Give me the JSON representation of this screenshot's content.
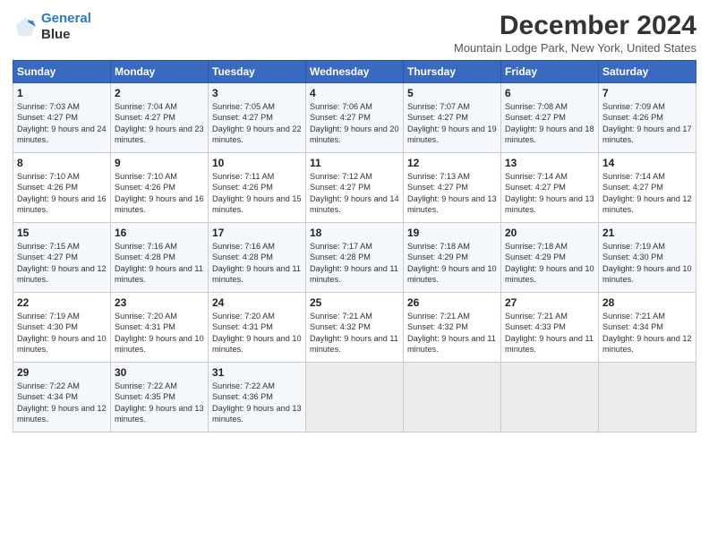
{
  "logo": {
    "line1": "General",
    "line2": "Blue"
  },
  "title": "December 2024",
  "location": "Mountain Lodge Park, New York, United States",
  "days_header": [
    "Sunday",
    "Monday",
    "Tuesday",
    "Wednesday",
    "Thursday",
    "Friday",
    "Saturday"
  ],
  "weeks": [
    [
      {
        "day": "1",
        "sunrise": "Sunrise: 7:03 AM",
        "sunset": "Sunset: 4:27 PM",
        "daylight": "Daylight: 9 hours and 24 minutes."
      },
      {
        "day": "2",
        "sunrise": "Sunrise: 7:04 AM",
        "sunset": "Sunset: 4:27 PM",
        "daylight": "Daylight: 9 hours and 23 minutes."
      },
      {
        "day": "3",
        "sunrise": "Sunrise: 7:05 AM",
        "sunset": "Sunset: 4:27 PM",
        "daylight": "Daylight: 9 hours and 22 minutes."
      },
      {
        "day": "4",
        "sunrise": "Sunrise: 7:06 AM",
        "sunset": "Sunset: 4:27 PM",
        "daylight": "Daylight: 9 hours and 20 minutes."
      },
      {
        "day": "5",
        "sunrise": "Sunrise: 7:07 AM",
        "sunset": "Sunset: 4:27 PM",
        "daylight": "Daylight: 9 hours and 19 minutes."
      },
      {
        "day": "6",
        "sunrise": "Sunrise: 7:08 AM",
        "sunset": "Sunset: 4:27 PM",
        "daylight": "Daylight: 9 hours and 18 minutes."
      },
      {
        "day": "7",
        "sunrise": "Sunrise: 7:09 AM",
        "sunset": "Sunset: 4:26 PM",
        "daylight": "Daylight: 9 hours and 17 minutes."
      }
    ],
    [
      {
        "day": "8",
        "sunrise": "Sunrise: 7:10 AM",
        "sunset": "Sunset: 4:26 PM",
        "daylight": "Daylight: 9 hours and 16 minutes."
      },
      {
        "day": "9",
        "sunrise": "Sunrise: 7:10 AM",
        "sunset": "Sunset: 4:26 PM",
        "daylight": "Daylight: 9 hours and 16 minutes."
      },
      {
        "day": "10",
        "sunrise": "Sunrise: 7:11 AM",
        "sunset": "Sunset: 4:26 PM",
        "daylight": "Daylight: 9 hours and 15 minutes."
      },
      {
        "day": "11",
        "sunrise": "Sunrise: 7:12 AM",
        "sunset": "Sunset: 4:27 PM",
        "daylight": "Daylight: 9 hours and 14 minutes."
      },
      {
        "day": "12",
        "sunrise": "Sunrise: 7:13 AM",
        "sunset": "Sunset: 4:27 PM",
        "daylight": "Daylight: 9 hours and 13 minutes."
      },
      {
        "day": "13",
        "sunrise": "Sunrise: 7:14 AM",
        "sunset": "Sunset: 4:27 PM",
        "daylight": "Daylight: 9 hours and 13 minutes."
      },
      {
        "day": "14",
        "sunrise": "Sunrise: 7:14 AM",
        "sunset": "Sunset: 4:27 PM",
        "daylight": "Daylight: 9 hours and 12 minutes."
      }
    ],
    [
      {
        "day": "15",
        "sunrise": "Sunrise: 7:15 AM",
        "sunset": "Sunset: 4:27 PM",
        "daylight": "Daylight: 9 hours and 12 minutes."
      },
      {
        "day": "16",
        "sunrise": "Sunrise: 7:16 AM",
        "sunset": "Sunset: 4:28 PM",
        "daylight": "Daylight: 9 hours and 11 minutes."
      },
      {
        "day": "17",
        "sunrise": "Sunrise: 7:16 AM",
        "sunset": "Sunset: 4:28 PM",
        "daylight": "Daylight: 9 hours and 11 minutes."
      },
      {
        "day": "18",
        "sunrise": "Sunrise: 7:17 AM",
        "sunset": "Sunset: 4:28 PM",
        "daylight": "Daylight: 9 hours and 11 minutes."
      },
      {
        "day": "19",
        "sunrise": "Sunrise: 7:18 AM",
        "sunset": "Sunset: 4:29 PM",
        "daylight": "Daylight: 9 hours and 10 minutes."
      },
      {
        "day": "20",
        "sunrise": "Sunrise: 7:18 AM",
        "sunset": "Sunset: 4:29 PM",
        "daylight": "Daylight: 9 hours and 10 minutes."
      },
      {
        "day": "21",
        "sunrise": "Sunrise: 7:19 AM",
        "sunset": "Sunset: 4:30 PM",
        "daylight": "Daylight: 9 hours and 10 minutes."
      }
    ],
    [
      {
        "day": "22",
        "sunrise": "Sunrise: 7:19 AM",
        "sunset": "Sunset: 4:30 PM",
        "daylight": "Daylight: 9 hours and 10 minutes."
      },
      {
        "day": "23",
        "sunrise": "Sunrise: 7:20 AM",
        "sunset": "Sunset: 4:31 PM",
        "daylight": "Daylight: 9 hours and 10 minutes."
      },
      {
        "day": "24",
        "sunrise": "Sunrise: 7:20 AM",
        "sunset": "Sunset: 4:31 PM",
        "daylight": "Daylight: 9 hours and 10 minutes."
      },
      {
        "day": "25",
        "sunrise": "Sunrise: 7:21 AM",
        "sunset": "Sunset: 4:32 PM",
        "daylight": "Daylight: 9 hours and 11 minutes."
      },
      {
        "day": "26",
        "sunrise": "Sunrise: 7:21 AM",
        "sunset": "Sunset: 4:32 PM",
        "daylight": "Daylight: 9 hours and 11 minutes."
      },
      {
        "day": "27",
        "sunrise": "Sunrise: 7:21 AM",
        "sunset": "Sunset: 4:33 PM",
        "daylight": "Daylight: 9 hours and 11 minutes."
      },
      {
        "day": "28",
        "sunrise": "Sunrise: 7:21 AM",
        "sunset": "Sunset: 4:34 PM",
        "daylight": "Daylight: 9 hours and 12 minutes."
      }
    ],
    [
      {
        "day": "29",
        "sunrise": "Sunrise: 7:22 AM",
        "sunset": "Sunset: 4:34 PM",
        "daylight": "Daylight: 9 hours and 12 minutes."
      },
      {
        "day": "30",
        "sunrise": "Sunrise: 7:22 AM",
        "sunset": "Sunset: 4:35 PM",
        "daylight": "Daylight: 9 hours and 13 minutes."
      },
      {
        "day": "31",
        "sunrise": "Sunrise: 7:22 AM",
        "sunset": "Sunset: 4:36 PM",
        "daylight": "Daylight: 9 hours and 13 minutes."
      },
      null,
      null,
      null,
      null
    ]
  ]
}
